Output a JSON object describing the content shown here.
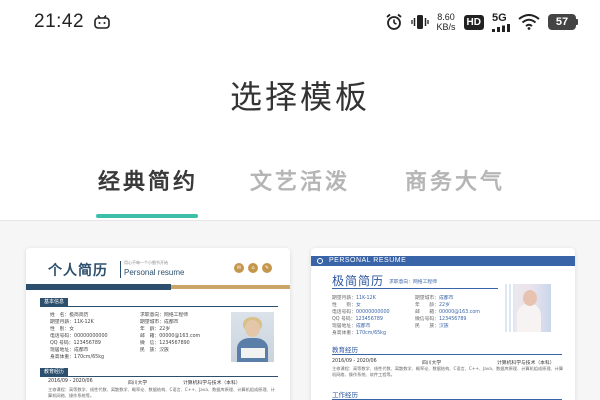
{
  "status_bar": {
    "time": "21:42",
    "net_speed_value": "8.60",
    "net_speed_unit": "KB/s",
    "hd_label": "HD",
    "network_label": "5G",
    "battery_level": "57"
  },
  "page": {
    "title": "选择模板"
  },
  "tabs": [
    {
      "label": "经典简约",
      "active": true
    },
    {
      "label": "文艺活泼",
      "active": false
    },
    {
      "label": "商务大气",
      "active": false
    }
  ],
  "colors": {
    "accent": "#3bbfa8",
    "template1_primary": "#2d4f6e",
    "template1_gold": "#c9a567",
    "template2_primary": "#3a64a8"
  },
  "templates": [
    {
      "title": "个人简历",
      "motto": "用心不每一个小细节开始",
      "subtitle": "Personal resume",
      "section_basic": "基本信息",
      "info": [
        {
          "label": "姓　名",
          "value": "极简简历"
        },
        {
          "label": "求职意向",
          "value": "网络工程师"
        },
        {
          "label": "期望月薪",
          "value": "11K-12K"
        },
        {
          "label": "期望城市",
          "value": "成都市"
        },
        {
          "label": "性　别",
          "value": "女"
        },
        {
          "label": "年　龄",
          "value": "22岁"
        },
        {
          "label": "电话号码",
          "value": "00000000000"
        },
        {
          "label": "邮　箱",
          "value": "00000@163.com"
        },
        {
          "label": "QQ 号码",
          "value": "123456789"
        },
        {
          "label": "微　信",
          "value": "1234567890"
        },
        {
          "label": "现居地址",
          "value": "成都市"
        },
        {
          "label": "民　族",
          "value": "汉族"
        },
        {
          "label": "身高体重",
          "value": "170cm/65kg"
        }
      ],
      "section_edu": "教育经历",
      "edu_period": "2016/09 - 2020/06",
      "edu_school": "四川大学",
      "edu_major": "计算机科学与技术（本科）",
      "edu_detail": "主修课程：高等数学、线性代数、离散数学、概率论、数据结构、C语言、C++、Java、数据库原理、计算机组成原理、计算机网络、操作系统等。"
    },
    {
      "header_label": "PERSONAL RESUME",
      "title": "极简简历",
      "intent": "求职意向：网络工程师",
      "info": [
        {
          "label": "期望月薪：",
          "value": "11K-12K"
        },
        {
          "label": "期望城市：",
          "value": "成都市"
        },
        {
          "label": "性　　别：",
          "value": "女"
        },
        {
          "label": "年　　龄：",
          "value": "22岁"
        },
        {
          "label": "电话号码：",
          "value": "00000000000"
        },
        {
          "label": "邮　　箱：",
          "value": "00000@163.com"
        },
        {
          "label": "QQ 号码：",
          "value": "123456789"
        },
        {
          "label": "微信号码：",
          "value": "123456789"
        },
        {
          "label": "现居地址：",
          "value": "成都市"
        },
        {
          "label": "民　　族：",
          "value": "汉族"
        },
        {
          "label": "身高体重：",
          "value": "170cm/65kg"
        }
      ],
      "section_edu": "教育经历",
      "edu_period": "2016/09 - 2020/06",
      "edu_school": "四川大学",
      "edu_major": "计算机科学与技术（本科）",
      "edu_detail": "主修课程：高等数学、线性代数、离散数学、概率论、数据结构、C语言、C++、Java、数据库原理、计算机组成原理、计算机网络、操作系统、软件工程等。",
      "section_work": "工作经历"
    }
  ]
}
